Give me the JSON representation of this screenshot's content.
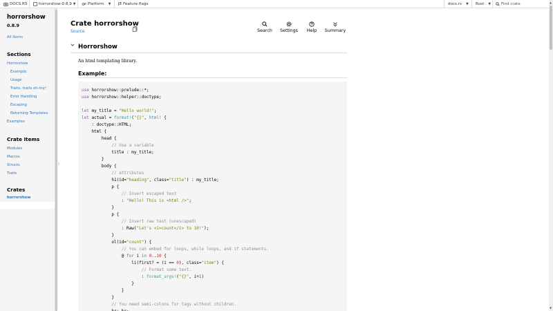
{
  "topbar": {
    "docsrs_label": "DOCS.RS",
    "crate_menu_label": "horrorshow-0.8.9",
    "platform_label": "Platform",
    "feature_flags_label": "Feature flags",
    "docsrs_menu_label": "docs.rs",
    "rust_menu_label": "Rust",
    "find_crate_placeholder": "Find crate"
  },
  "sidebar": {
    "crate_name": "horrorshow",
    "version": "0.8.9",
    "all_items": "All Items",
    "sections_heading": "Sections",
    "sections": [
      "Horrorshow",
      "Example:",
      "Usage",
      "Traits, traits oh-my!",
      "Error Handling",
      "Escaping",
      "Returning Templates",
      "Examples"
    ],
    "crate_items_heading": "Crate Items",
    "crate_items": [
      "Modules",
      "Macros",
      "Structs",
      "Traits"
    ],
    "crates_heading": "Crates",
    "crates": [
      "horrorshow"
    ]
  },
  "main": {
    "title": "Crate horrorshow",
    "source_label": "Source",
    "tools": {
      "search": "Search",
      "settings": "Settings",
      "help": "Help",
      "summary": "Summary"
    },
    "section_title": "Horrorshow",
    "description": "An html templating library.",
    "example_heading": "Example:"
  },
  "code_lines": [
    [
      [
        "kw",
        "use"
      ],
      [
        "t",
        " horrorshow::prelude::*;"
      ]
    ],
    [
      [
        "kw",
        "use"
      ],
      [
        "t",
        " horrorshow::helper::doctype;"
      ]
    ],
    [
      [
        "t",
        ""
      ]
    ],
    [
      [
        "kw",
        "let"
      ],
      [
        "t",
        " my_title = "
      ],
      [
        "str",
        "\"Hello world!\""
      ],
      [
        "t",
        ";"
      ]
    ],
    [
      [
        "kw",
        "let"
      ],
      [
        "t",
        " actual = "
      ],
      [
        "mac",
        "format!"
      ],
      [
        "t",
        "("
      ],
      [
        "str",
        "\"{}\""
      ],
      [
        "t",
        ", "
      ],
      [
        "mac",
        "html!"
      ],
      [
        "t",
        " {"
      ]
    ],
    [
      [
        "t",
        "    : doctype::HTML;"
      ]
    ],
    [
      [
        "t",
        "    html {"
      ]
    ],
    [
      [
        "t",
        "        head {"
      ]
    ],
    [
      [
        "cmt",
        "            // Use a variable"
      ]
    ],
    [
      [
        "t",
        "            title : my_title;"
      ]
    ],
    [
      [
        "t",
        "        }"
      ]
    ],
    [
      [
        "t",
        "        body {"
      ]
    ],
    [
      [
        "cmt",
        "            // attributes"
      ]
    ],
    [
      [
        "t",
        "            h1(id="
      ],
      [
        "str",
        "\"heading\""
      ],
      [
        "t",
        ", class="
      ],
      [
        "str",
        "\"title\""
      ],
      [
        "t",
        ") : my_title;"
      ]
    ],
    [
      [
        "t",
        "            p {"
      ]
    ],
    [
      [
        "cmt",
        "                // Insert escaped text"
      ]
    ],
    [
      [
        "t",
        "                : "
      ],
      [
        "str",
        "\"Hello! This is <html />\""
      ],
      [
        "t",
        ";"
      ]
    ],
    [
      [
        "t",
        "            }"
      ]
    ],
    [
      [
        "t",
        "            p {"
      ]
    ],
    [
      [
        "cmt",
        "                // Insert raw text (unescaped)"
      ]
    ],
    [
      [
        "t",
        "                : Raw("
      ],
      [
        "str",
        "\"Let's <i>count</i> to 10!\""
      ],
      [
        "t",
        ");"
      ]
    ],
    [
      [
        "t",
        "            }"
      ]
    ],
    [
      [
        "t",
        "            ol(id="
      ],
      [
        "str",
        "\"count\""
      ],
      [
        "t",
        ") {"
      ]
    ],
    [
      [
        "cmt",
        "                // You can embed for loops, while loops, and if statements."
      ]
    ],
    [
      [
        "t",
        "                @ "
      ],
      [
        "kw",
        "for"
      ],
      [
        "t",
        " i "
      ],
      [
        "kw",
        "in"
      ],
      [
        "t",
        " "
      ],
      [
        "num",
        "0"
      ],
      [
        "t",
        ".."
      ],
      [
        "num",
        "10"
      ],
      [
        "t",
        " {"
      ]
    ],
    [
      [
        "t",
        "                    li(first? = (i == "
      ],
      [
        "num",
        "0"
      ],
      [
        "t",
        "), class="
      ],
      [
        "str",
        "\"item\""
      ],
      [
        "t",
        ") {"
      ]
    ],
    [
      [
        "cmt",
        "                        // Format some text."
      ]
    ],
    [
      [
        "t",
        "                        : "
      ],
      [
        "mac",
        "format_args!"
      ],
      [
        "t",
        "("
      ],
      [
        "str",
        "\"{}\""
      ],
      [
        "t",
        ", i+"
      ],
      [
        "num",
        "1"
      ],
      [
        "t",
        ")"
      ]
    ],
    [
      [
        "t",
        "                    }"
      ]
    ],
    [
      [
        "t",
        "                }"
      ]
    ],
    [
      [
        "t",
        "            }"
      ]
    ],
    [
      [
        "cmt",
        "            // You need semi-colons for tags without children."
      ]
    ],
    [
      [
        "t",
        "            br; br;"
      ]
    ]
  ]
}
